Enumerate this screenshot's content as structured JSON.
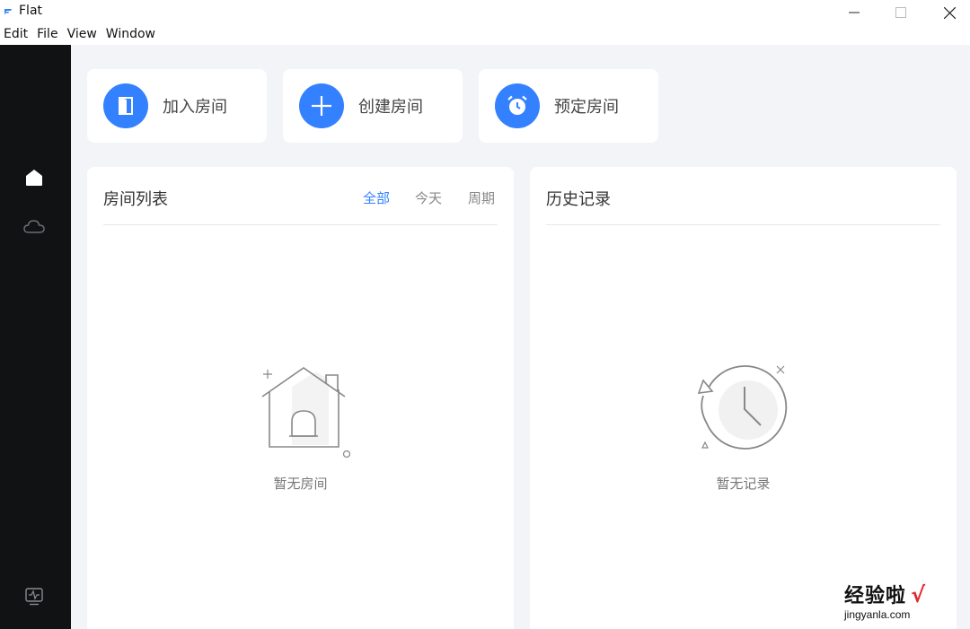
{
  "window": {
    "title": "Flat",
    "minimize_icon": "minimize-icon",
    "maximize_icon": "maximize-icon",
    "close_icon": "close-icon"
  },
  "menu": [
    "Edit",
    "File",
    "View",
    "Window"
  ],
  "sidebar": {
    "items": [
      {
        "icon": "home-icon",
        "active": true
      },
      {
        "icon": "cloud-icon",
        "active": false
      }
    ],
    "bottom_icon": "monitor-icon"
  },
  "actions": [
    {
      "label": "加入房间",
      "icon": "door-icon"
    },
    {
      "label": "创建房间",
      "icon": "plus-icon"
    },
    {
      "label": "预定房间",
      "icon": "alarm-clock-icon"
    }
  ],
  "room_list": {
    "title": "房间列表",
    "filters": [
      "全部",
      "今天",
      "周期"
    ],
    "active_filter": "全部",
    "empty_text": "暂无房间"
  },
  "history": {
    "title": "历史记录",
    "empty_text": "暂无记录"
  },
  "watermark": {
    "main": "经验啦",
    "check": "√",
    "sub": "jingyanla.com"
  },
  "colors": {
    "accent": "#3381ff",
    "sidebar_bg": "#111214",
    "main_bg": "#f3f4f8"
  }
}
